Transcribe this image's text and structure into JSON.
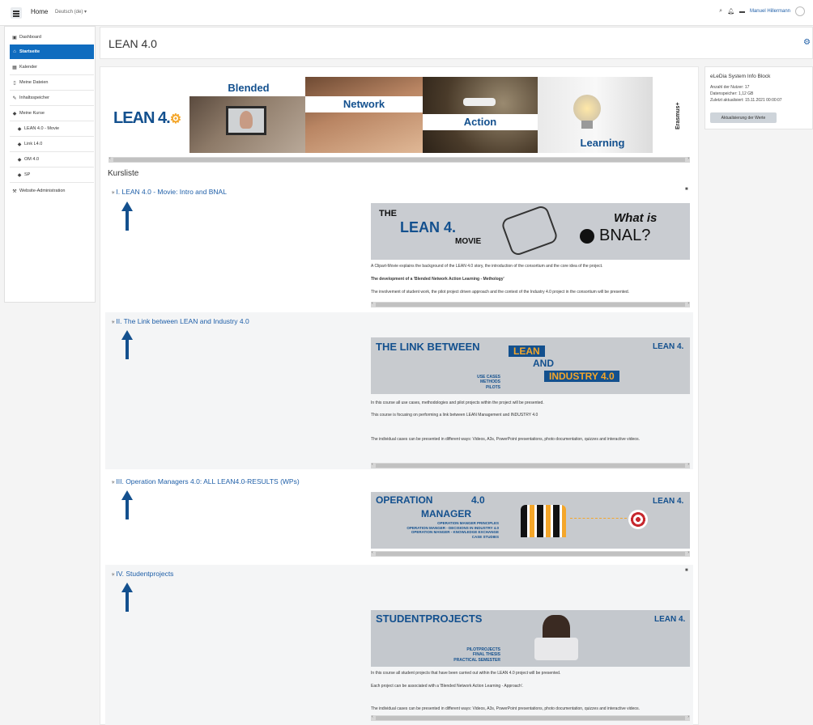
{
  "navbar": {
    "home": "Home",
    "language": "Deutsch (de) ▾",
    "user_name": "Manuel Hillermann",
    "icons": [
      "search-icon",
      "bell-icon",
      "chat-icon"
    ]
  },
  "sidebar": {
    "items": [
      {
        "label": "Dashboard",
        "icon": "dashboard-icon"
      },
      {
        "label": "Startseite",
        "icon": "home-icon"
      },
      {
        "label": "Kalender",
        "icon": "calendar-icon"
      },
      {
        "label": "Meine Dateien",
        "icon": "file-icon"
      },
      {
        "label": "Inhaltsspeicher",
        "icon": "pencil-icon"
      },
      {
        "label": "Meine Kurse",
        "icon": "graduation-cap-icon"
      },
      {
        "label": "LEAN 4.0 - Movie",
        "icon": "graduation-cap-icon"
      },
      {
        "label": "Link L4.0",
        "icon": "graduation-cap-icon"
      },
      {
        "label": "OM 4.0",
        "icon": "graduation-cap-icon"
      },
      {
        "label": "SP",
        "icon": "graduation-cap-icon"
      },
      {
        "label": "Website-Administration",
        "icon": "wrench-icon"
      }
    ]
  },
  "page": {
    "title": "LEAN 4.0"
  },
  "info_block": {
    "title": "eLeDia System Info Block",
    "lines": [
      "Anzahl der Nutzer: 17",
      "Datenspeicher: 1,12 GB",
      "Zuletzt aktualisiert: 15.11.2021 00:00:07"
    ],
    "button": "Aktualisierung der Werte"
  },
  "banner": {
    "logo": "LEAN 4.",
    "words": [
      "Blended",
      "Network",
      "Action",
      "Learning"
    ],
    "erasmus": "Erasmus+"
  },
  "kursliste": "Kursliste",
  "sections": [
    {
      "title": "I. LEAN 4.0 - Movie: Intro and BNAL",
      "image": {
        "the": "THE",
        "main": "LEAN 4.",
        "sub": "MOVIE",
        "what": "What is",
        "bnal": "BNAL?"
      },
      "desc": [
        "A Clipart-Movie explains the background of the LEAN 4.0 story, the introduction of the consortium and the core idea of the project.",
        "The development of a 'Blended Network Action Learning - Methology'",
        "The involvement of student work, the pilot project driven approach and the context of the Industry 4.0 project in the consortium will be presented."
      ]
    },
    {
      "title": "II. The Link between LEAN and Industry 4.0",
      "image": {
        "main": "THE LINK BETWEEN",
        "lean": "LEAN",
        "and": "AND",
        "industry": "INDUSTRY 4.0",
        "small": [
          "USE CASES",
          "METHODS",
          "PILOTS"
        ],
        "logo": "LEAN 4."
      },
      "desc": [
        "In this course all use cases, methodologies and pilot projects within the project will be presented.",
        "This course is focusing on performing a link between LEAN Management and INDUSTRY 4.0",
        "The individual cases can be presented in different ways: Videos, A3s, PowerPoint presentations, photo documentation, quizzes and interactive videos."
      ]
    },
    {
      "title": "III. Operation Managers 4.0: ALL LEAN4.0-RESULTS (WPs)",
      "image": {
        "op": "OPERATION",
        "num": "4.0",
        "mgr": "MANAGER",
        "small": [
          "OPERATION MANGER PRINCIPLES",
          "OPERATION MANGER - DECISIONS IN INDUSTRY 4.0",
          "OPERATION MANGER - KNOWLEDGE EXCHANGE",
          "CASE STUDIES"
        ],
        "logo": "LEAN 4."
      }
    },
    {
      "title": "IV. Studentprojects",
      "image": {
        "main": "STUDENTPROJECTS",
        "small": [
          "PILOTPROJECTS",
          "FINAL THESIS",
          "PRACTICAL SEMESTER"
        ],
        "logo": "LEAN 4."
      },
      "desc": [
        "In this course all student projects that have been carried out within the LEAN 4.0 project will be presented.",
        "Each project can be associated with a 'Blended Network Action Learning - Approach'.",
        "The individual cases can be presented in different ways: Videos, A3s, PowerPoint presentations, photo documentation, quizzes and interactive videos."
      ]
    }
  ]
}
